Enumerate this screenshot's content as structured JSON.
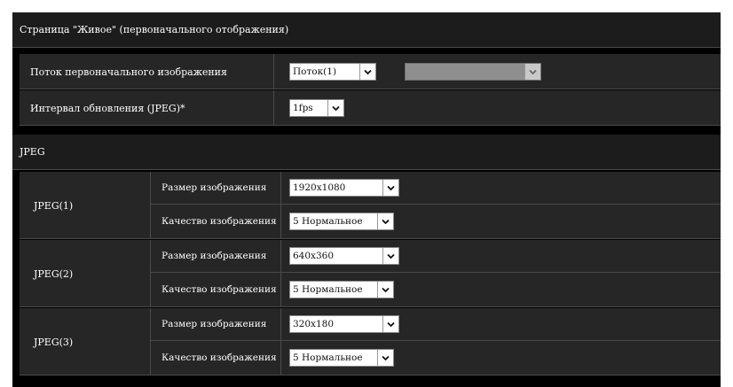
{
  "header": {
    "title": "Страница \"Живое\" (первоначального отображения)"
  },
  "initial_stream": {
    "label": "Поток первоначального изображения",
    "stream_select": {
      "value": "Поток(1)"
    },
    "secondary_select": {
      "value": ""
    }
  },
  "refresh_interval": {
    "label": "Интервал обновления (JPEG)*",
    "select": {
      "value": "1fps"
    }
  },
  "jpeg_section": {
    "title": "JPEG"
  },
  "jpeg_groups": [
    {
      "name": "JPEG(1)",
      "size_label": "Размер изображения",
      "size_value": "1920x1080",
      "quality_label": "Качество изображения",
      "quality_value": "5 Нормальное"
    },
    {
      "name": "JPEG(2)",
      "size_label": "Размер изображения",
      "size_value": "640x360",
      "quality_label": "Качество изображения",
      "quality_value": "5 Нормальное"
    },
    {
      "name": "JPEG(3)",
      "size_label": "Размер изображения",
      "size_value": "320x180",
      "quality_label": "Качество изображения",
      "quality_value": "5 Нормальное"
    }
  ],
  "colors": {
    "background": "#000000",
    "row": "#262626",
    "border": "#4a4a4a",
    "disabled": "#8f8f8f"
  }
}
